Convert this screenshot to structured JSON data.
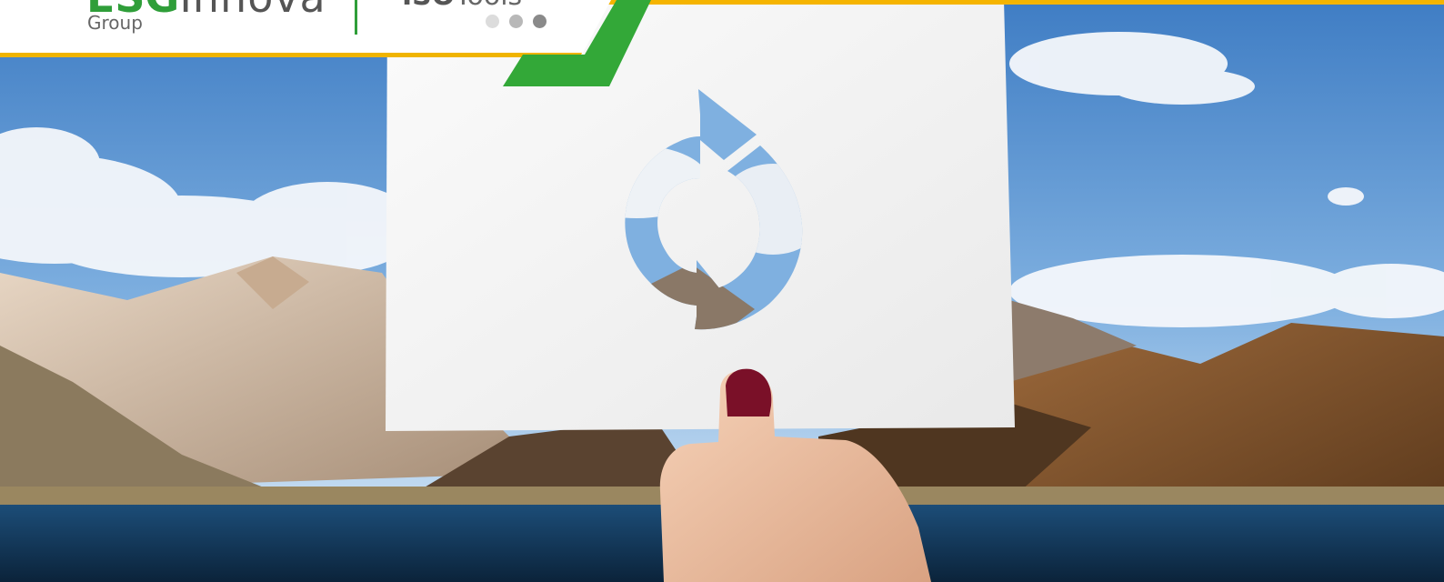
{
  "header": {
    "brand_main_prefix": "ESG",
    "brand_main_rest": "Innova",
    "brand_sub": "Group",
    "iso_prefix": "ISO",
    "iso_rest": "Tools",
    "carousel_dots": [
      {
        "color": "#dcdcdc",
        "active": false
      },
      {
        "color": "#b8b8b8",
        "active": false
      },
      {
        "color": "#8a8a8a",
        "active": true
      }
    ]
  },
  "colors": {
    "accent_green": "#2f9e39",
    "accent_yellow": "#f5b400",
    "sky": "#4a86c8",
    "lake": "#14324f"
  },
  "hero": {
    "icon": "refresh-icon"
  }
}
